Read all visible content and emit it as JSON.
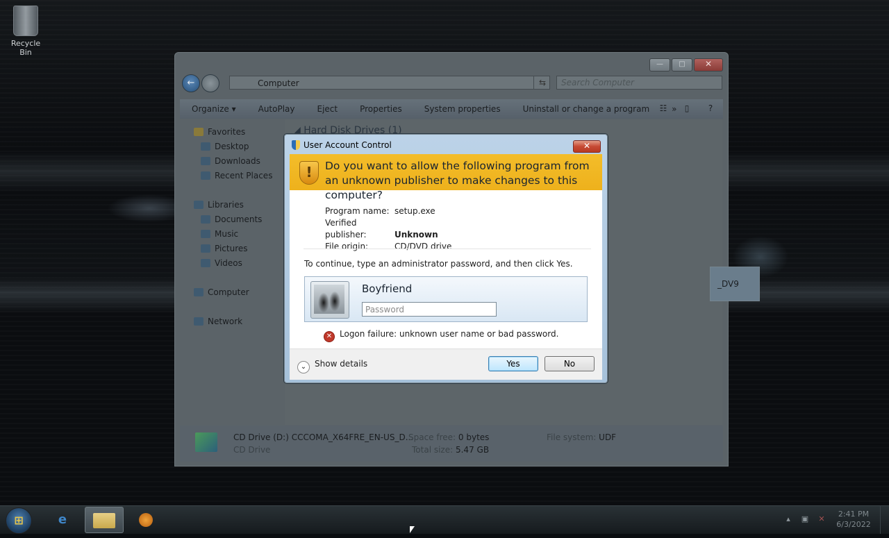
{
  "desktop": {
    "icons": [
      {
        "label": "Recycle Bin",
        "icon": "recycle-bin-icon"
      }
    ]
  },
  "explorer": {
    "window_controls": {
      "minimize": "—",
      "maximize": "□",
      "close": "✕"
    },
    "address": "Computer",
    "search_placeholder": "Search Computer",
    "toolbar": [
      "Organize ▾",
      "AutoPlay",
      "Eject",
      "Properties",
      "System properties",
      "Uninstall or change a program",
      "»"
    ],
    "nav": {
      "favorites": "Favorites",
      "desktop": "Desktop",
      "downloads": "Downloads",
      "recent": "Recent Places",
      "libraries": "Libraries",
      "documents": "Documents",
      "music": "Music",
      "pictures": "Pictures",
      "videos": "Videos",
      "computer": "Computer",
      "network": "Network"
    },
    "content": {
      "group_header": "Hard Disk Drives (1)",
      "drive_tile_label": "_DV9"
    },
    "status": {
      "drive_name": "CD Drive (D:) CCCOMA_X64FRE_EN-US_D...",
      "drive_type": "CD Drive",
      "space_free_label": "Space free:",
      "space_free": "0 bytes",
      "total_size_label": "Total size:",
      "total_size": "5.47 GB",
      "fs_label": "File system:",
      "fs": "UDF"
    }
  },
  "uac": {
    "title": "User Account Control",
    "close": "✕",
    "question": "Do you want to allow the following program from an unknown publisher to make changes to this computer?",
    "program_name_label": "Program name:",
    "program_name": "setup.exe",
    "publisher_label": "Verified publisher:",
    "publisher": "Unknown",
    "origin_label": "File origin:",
    "origin": "CD/DVD drive",
    "prompt": "To continue, type an administrator password, and then click Yes.",
    "user_name": "Boyfriend",
    "password_placeholder": "Password",
    "error": "Logon failure: unknown user name or bad password.",
    "show_details": "Show details",
    "yes": "Yes",
    "no": "No"
  },
  "taskbar": {
    "clock_time": "2:41 PM",
    "clock_date": "6/3/2022",
    "tray_arrow": "▴"
  },
  "colors": {
    "uac_banner": "#eeb11c",
    "uac_frame": "#a6c1da",
    "desktop_bg": "#0a0d10"
  }
}
